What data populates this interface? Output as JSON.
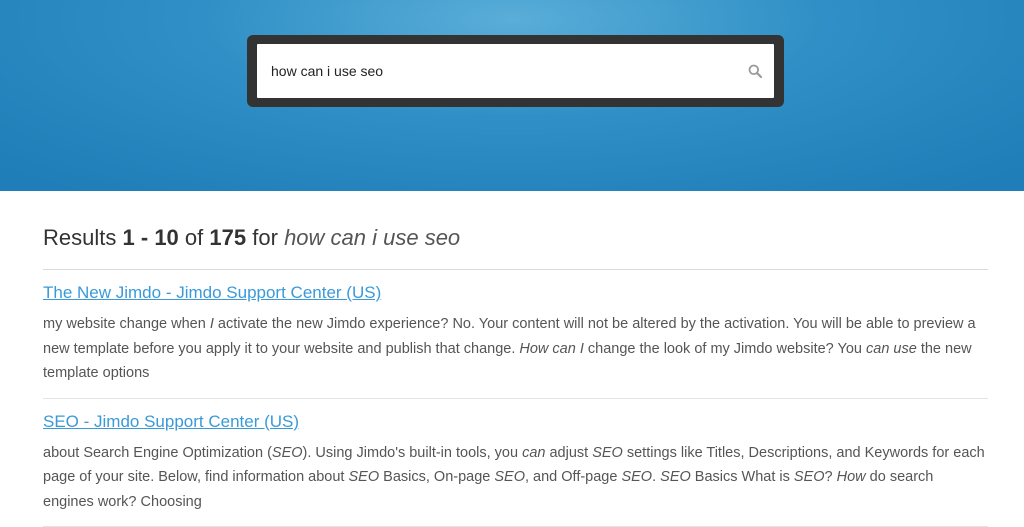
{
  "search": {
    "query": "how can i use seo",
    "icon": "search-icon"
  },
  "results_header": {
    "prefix": "Results",
    "start": "1",
    "dash": "-",
    "end": "10",
    "of": "of",
    "total": "175",
    "for": "for",
    "query": "how can i use seo"
  },
  "results": [
    {
      "title": "The New Jimdo - Jimdo Support Center (US)",
      "snippet": [
        {
          "t": "my website change when ",
          "em": false
        },
        {
          "t": "I",
          "em": true
        },
        {
          "t": " activate the new Jimdo experience? No. Your content will not be altered by the activation. You will be able to preview a new template before you apply it to your website and publish that change. ",
          "em": false
        },
        {
          "t": "How can I",
          "em": true
        },
        {
          "t": " change the look of my Jimdo website? You ",
          "em": false
        },
        {
          "t": "can use",
          "em": true
        },
        {
          "t": " the new template options",
          "em": false
        }
      ]
    },
    {
      "title": "SEO - Jimdo Support Center (US)",
      "snippet": [
        {
          "t": "about Search Engine Optimization (",
          "em": false
        },
        {
          "t": "SEO",
          "em": true
        },
        {
          "t": "). Using Jimdo's built-in tools, you ",
          "em": false
        },
        {
          "t": "can",
          "em": true
        },
        {
          "t": " adjust ",
          "em": false
        },
        {
          "t": "SEO",
          "em": true
        },
        {
          "t": " settings like Titles, Descriptions, and Keywords for each page of your site. Below, find information about ",
          "em": false
        },
        {
          "t": "SEO",
          "em": true
        },
        {
          "t": " Basics, On-page ",
          "em": false
        },
        {
          "t": "SEO",
          "em": true
        },
        {
          "t": ", and Off-page ",
          "em": false
        },
        {
          "t": "SEO",
          "em": true
        },
        {
          "t": ".    ",
          "em": false
        },
        {
          "t": "SEO",
          "em": true
        },
        {
          "t": " Basics What is ",
          "em": false
        },
        {
          "t": "SEO",
          "em": true
        },
        {
          "t": "? ",
          "em": false
        },
        {
          "t": "How",
          "em": true
        },
        {
          "t": " do search engines work? Choosing",
          "em": false
        }
      ]
    }
  ]
}
